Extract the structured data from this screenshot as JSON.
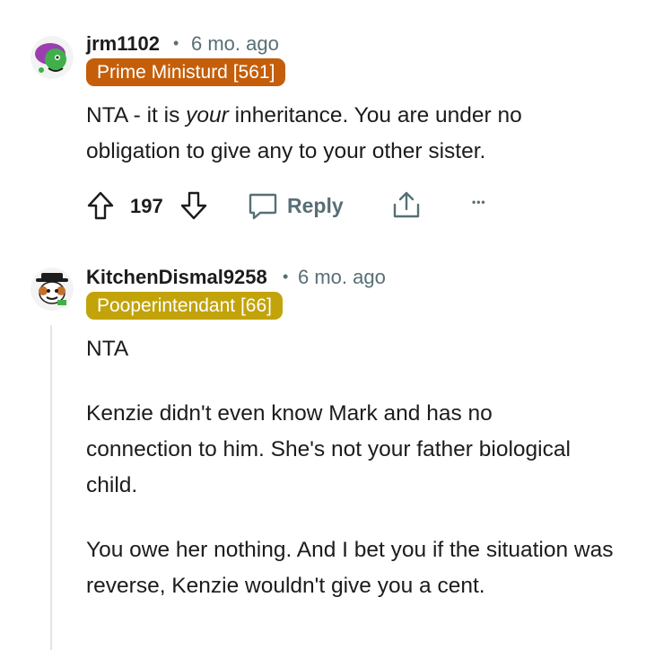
{
  "comments": [
    {
      "username": "jrm1102",
      "separator": "•",
      "time": "6 mo. ago",
      "flair": "Prime Ministurd [561]",
      "flair_color": "#c45e0a",
      "body_prefix": "NTA - it is ",
      "body_emphasis": "your",
      "body_suffix": " inheritance. You are under no obligation to give any to your other sister.",
      "upvotes": "197",
      "reply_label": "Reply",
      "more_label": "•••"
    },
    {
      "username": "KitchenDismal9258",
      "separator": "•",
      "time": "6 mo. ago",
      "flair": "Pooperintendant [66]",
      "flair_color": "#c2a30a",
      "paragraphs": [
        "NTA",
        "Kenzie didn't even know Mark and has no connection to him. She's not your father biological child.",
        "You owe her nothing. And I bet you if the situation was reverse, Kenzie wouldn't give you a cent."
      ]
    }
  ],
  "icons": {
    "upvote": "upvote-arrow-icon",
    "downvote": "downvote-arrow-icon",
    "reply": "speech-bubble-icon",
    "share": "share-icon",
    "more": "ellipsis-icon"
  },
  "colors": {
    "meta_gray": "#576f76",
    "text": "#1c1c1c",
    "thread_line": "#e3e6e8"
  }
}
